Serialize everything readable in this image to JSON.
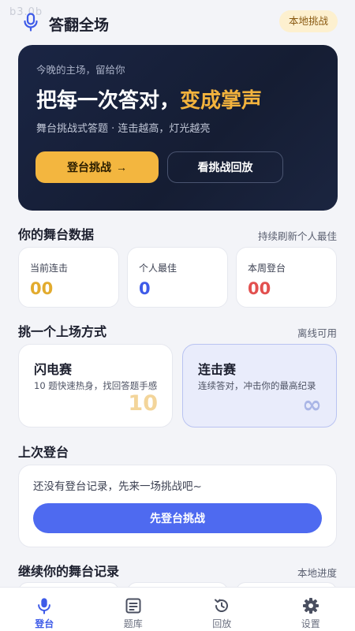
{
  "watermark": "b3.0b",
  "header": {
    "title": "答翻全场",
    "badge": "本地挑战"
  },
  "hero": {
    "kicker": "今晚的主场，留给你",
    "title_main": "把每一次答对，",
    "title_highlight": "变成掌声",
    "subtitle": "舞台挑战式答题 · 连击越高，灯光越亮",
    "primary_button": "登台挑战",
    "primary_arrow": "→",
    "secondary_button": "看挑战回放"
  },
  "stats": {
    "title": "你的舞台数据",
    "right_note": "持续刷新个人最佳",
    "items": [
      {
        "label": "当前连击",
        "value": "00",
        "color": "#e2ab2e"
      },
      {
        "label": "个人最佳",
        "value": "0",
        "color": "#3e5be8"
      },
      {
        "label": "本周登台",
        "value": "00",
        "color": "#e2504f"
      }
    ]
  },
  "modes": {
    "title": "挑一个上场方式",
    "right_note": "离线可用",
    "items": [
      {
        "name": "闪电赛",
        "desc": "10 题快速热身，找回答题手感",
        "big": "10"
      },
      {
        "name": "连击赛",
        "desc": "连续答对，冲击你的最高纪录",
        "big": "∞"
      }
    ]
  },
  "last": {
    "title": "上次登台",
    "empty_text": "还没有登台记录，先来一场挑战吧~",
    "button": "先登台挑战"
  },
  "records": {
    "title": "继续你的舞台记录",
    "right_note": "本地进度"
  },
  "tabs": [
    {
      "label": "登台",
      "icon": "mic-icon",
      "active": true
    },
    {
      "label": "题库",
      "icon": "book-icon",
      "active": false
    },
    {
      "label": "回放",
      "icon": "replay-icon",
      "active": false
    },
    {
      "label": "设置",
      "icon": "gear-icon",
      "active": false
    }
  ]
}
